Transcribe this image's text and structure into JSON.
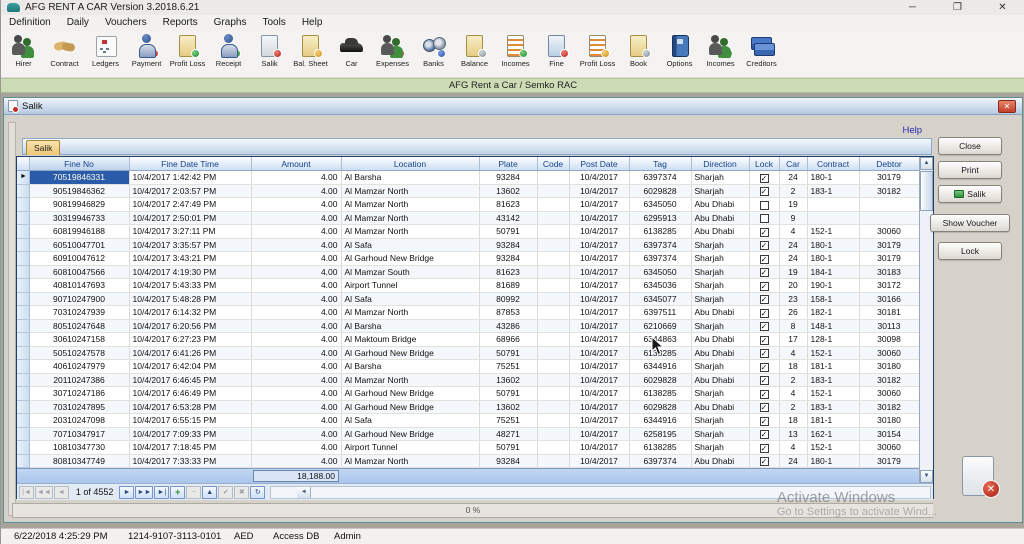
{
  "window": {
    "title": "AFG RENT A CAR Version 3.2018.6.21",
    "controls": [
      {
        "name": "minimize",
        "glyph": "─"
      },
      {
        "name": "maximize",
        "glyph": "❐"
      },
      {
        "name": "close",
        "glyph": "✕"
      }
    ]
  },
  "menu": [
    "Definition",
    "Daily",
    "Vouchers",
    "Reports",
    "Graphs",
    "Tools",
    "Help"
  ],
  "toolbar": [
    {
      "name": "hirer",
      "label": "Hirer",
      "shape": "people",
      "badge": "none"
    },
    {
      "name": "contract",
      "label": "Contract",
      "shape": "hands",
      "badge": "none"
    },
    {
      "name": "ledgers",
      "label": "Ledgers",
      "shape": "card",
      "badge": "none"
    },
    {
      "name": "payment",
      "label": "Payment",
      "shape": "person",
      "badge": "red"
    },
    {
      "name": "profit-loss-1",
      "label": "Profit Loss",
      "shape": "doc-yellow",
      "badge": "green"
    },
    {
      "name": "receipt",
      "label": "Receipt",
      "shape": "person",
      "badge": "green"
    },
    {
      "name": "salik",
      "label": "Salik",
      "shape": "doc-gray",
      "badge": "red"
    },
    {
      "name": "bal-sheet",
      "label": "Bal. Sheet",
      "shape": "doc-yellow",
      "badge": "yellow"
    },
    {
      "name": "car",
      "label": "Car",
      "shape": "car",
      "badge": "none"
    },
    {
      "name": "expenses",
      "label": "Expenses",
      "shape": "people",
      "badge": "red"
    },
    {
      "name": "banks",
      "label": "Banks",
      "shape": "binoc",
      "badge": "blue"
    },
    {
      "name": "balance",
      "label": "Balance",
      "shape": "doc-yellow",
      "badge": "gray"
    },
    {
      "name": "incomes-1",
      "label": "Incomes",
      "shape": "doc-lines",
      "badge": "green"
    },
    {
      "name": "fine",
      "label": "Fine",
      "shape": "doc-blue",
      "badge": "red"
    },
    {
      "name": "profit-loss-2",
      "label": "Profit Loss",
      "shape": "doc-lines",
      "badge": "yellow"
    },
    {
      "name": "book",
      "label": "Book",
      "shape": "doc-yellow",
      "badge": "gray"
    },
    {
      "name": "options",
      "label": "Options",
      "shape": "book",
      "badge": "none"
    },
    {
      "name": "incomes-2",
      "label": "Incomes",
      "shape": "people",
      "badge": "green"
    },
    {
      "name": "creditors",
      "label": "Creditors",
      "shape": "cards",
      "badge": "none"
    }
  ],
  "banner": "AFG Rent a Car / Semko RAC",
  "salik_window": {
    "title": "Salik",
    "close_glyph": "✕",
    "help": "Help",
    "tab": "Salik",
    "grid": {
      "columns": [
        "Fine No",
        "Fine Date Time",
        "Amount",
        "Location",
        "Plate",
        "Code",
        "Post Date",
        "Tag",
        "Direction",
        "Lock",
        "Car",
        "Contract",
        "Debtor"
      ],
      "rows": [
        [
          "70519846331",
          "10/4/2017 1:42:42 PM",
          "4.00",
          "Al Barsha",
          "93284",
          "",
          "10/4/2017",
          "6397374",
          "Sharjah",
          true,
          "24",
          "180-1",
          "30179"
        ],
        [
          "90519846362",
          "10/4/2017 2:03:57 PM",
          "4.00",
          "Al Mamzar North",
          "13602",
          "",
          "10/4/2017",
          "6029828",
          "Sharjah",
          true,
          "2",
          "183-1",
          "30182"
        ],
        [
          "90819946829",
          "10/4/2017 2:47:49 PM",
          "4.00",
          "Al Mamzar North",
          "81623",
          "",
          "10/4/2017",
          "6345050",
          "Abu Dhabi",
          false,
          "19",
          "",
          ""
        ],
        [
          "30319946733",
          "10/4/2017 2:50:01 PM",
          "4.00",
          "Al Mamzar North",
          "43142",
          "",
          "10/4/2017",
          "6295913",
          "Abu Dhabi",
          false,
          "9",
          "",
          ""
        ],
        [
          "60819946188",
          "10/4/2017 3:27:11 PM",
          "4.00",
          "Al Mamzar North",
          "50791",
          "",
          "10/4/2017",
          "6138285",
          "Abu Dhabi",
          true,
          "4",
          "152-1",
          "30060"
        ],
        [
          "60510047701",
          "10/4/2017 3:35:57 PM",
          "4.00",
          "Al Safa",
          "93284",
          "",
          "10/4/2017",
          "6397374",
          "Sharjah",
          true,
          "24",
          "180-1",
          "30179"
        ],
        [
          "60910047612",
          "10/4/2017 3:43:21 PM",
          "4.00",
          "Al Garhoud New Bridge",
          "93284",
          "",
          "10/4/2017",
          "6397374",
          "Sharjah",
          true,
          "24",
          "180-1",
          "30179"
        ],
        [
          "60810047566",
          "10/4/2017 4:19:30 PM",
          "4.00",
          "Al Mamzar South",
          "81623",
          "",
          "10/4/2017",
          "6345050",
          "Sharjah",
          true,
          "19",
          "184-1",
          "30183"
        ],
        [
          "40810147693",
          "10/4/2017 5:43:33 PM",
          "4.00",
          "Airport Tunnel",
          "81689",
          "",
          "10/4/2017",
          "6345036",
          "Sharjah",
          true,
          "20",
          "190-1",
          "30172"
        ],
        [
          "90710247900",
          "10/4/2017 5:48:28 PM",
          "4.00",
          "Al Safa",
          "80992",
          "",
          "10/4/2017",
          "6345077",
          "Sharjah",
          true,
          "23",
          "158-1",
          "30166"
        ],
        [
          "70310247939",
          "10/4/2017 6:14:32 PM",
          "4.00",
          "Al Mamzar North",
          "87853",
          "",
          "10/4/2017",
          "6397511",
          "Abu Dhabi",
          true,
          "26",
          "182-1",
          "30181"
        ],
        [
          "80510247648",
          "10/4/2017 6:20:56 PM",
          "4.00",
          "Al Barsha",
          "43286",
          "",
          "10/4/2017",
          "6210669",
          "Sharjah",
          true,
          "8",
          "148-1",
          "30113"
        ],
        [
          "30610247158",
          "10/4/2017 6:27:23 PM",
          "4.00",
          "Al Maktoum Bridge",
          "68966",
          "",
          "10/4/2017",
          "6344863",
          "Abu Dhabi",
          true,
          "17",
          "128-1",
          "30098"
        ],
        [
          "50510247578",
          "10/4/2017 6:41:26 PM",
          "4.00",
          "Al Garhoud New Bridge",
          "50791",
          "",
          "10/4/2017",
          "6138285",
          "Abu Dhabi",
          true,
          "4",
          "152-1",
          "30060"
        ],
        [
          "40610247979",
          "10/4/2017 6:42:04 PM",
          "4.00",
          "Al Barsha",
          "75251",
          "",
          "10/4/2017",
          "6344916",
          "Sharjah",
          true,
          "18",
          "181-1",
          "30180"
        ],
        [
          "20110247386",
          "10/4/2017 6:46:45 PM",
          "4.00",
          "Al Mamzar North",
          "13602",
          "",
          "10/4/2017",
          "6029828",
          "Abu Dhabi",
          true,
          "2",
          "183-1",
          "30182"
        ],
        [
          "30710247186",
          "10/4/2017 6:46:49 PM",
          "4.00",
          "Al Garhoud New Bridge",
          "50791",
          "",
          "10/4/2017",
          "6138285",
          "Sharjah",
          true,
          "4",
          "152-1",
          "30060"
        ],
        [
          "70310247895",
          "10/4/2017 6:53:28 PM",
          "4.00",
          "Al Garhoud New Bridge",
          "13602",
          "",
          "10/4/2017",
          "6029828",
          "Abu Dhabi",
          true,
          "2",
          "183-1",
          "30182"
        ],
        [
          "20310247098",
          "10/4/2017 6:55:15 PM",
          "4.00",
          "Al Safa",
          "75251",
          "",
          "10/4/2017",
          "6344916",
          "Sharjah",
          true,
          "18",
          "181-1",
          "30180"
        ],
        [
          "70710347917",
          "10/4/2017 7:09:33 PM",
          "4.00",
          "Al Garhoud New Bridge",
          "48271",
          "",
          "10/4/2017",
          "6258195",
          "Sharjah",
          true,
          "13",
          "162-1",
          "30154"
        ],
        [
          "10810347730",
          "10/4/2017 7:18:45 PM",
          "4.00",
          "Airport Tunnel",
          "50791",
          "",
          "10/4/2017",
          "6138285",
          "Sharjah",
          true,
          "4",
          "152-1",
          "30060"
        ],
        [
          "80810347749",
          "10/4/2017 7:33:33 PM",
          "4.00",
          "Al Mamzar North",
          "93284",
          "",
          "10/4/2017",
          "6397374",
          "Abu Dhabi",
          true,
          "24",
          "180-1",
          "30179"
        ]
      ],
      "total": "18,188.00"
    },
    "navigator": {
      "position": "1 of 4552",
      "buttons_left": [
        {
          "name": "first",
          "glyph": "|◄",
          "enabled": false
        },
        {
          "name": "prior-page",
          "glyph": "◄◄",
          "enabled": false
        },
        {
          "name": "prior",
          "glyph": "◄",
          "enabled": false
        }
      ],
      "buttons_right": [
        {
          "name": "next",
          "glyph": "►",
          "enabled": true
        },
        {
          "name": "next-page",
          "glyph": "►►",
          "enabled": true
        },
        {
          "name": "last",
          "glyph": "►|",
          "enabled": true
        },
        {
          "name": "insert",
          "glyph": "+",
          "enabled": true,
          "accent": "green"
        },
        {
          "name": "delete",
          "glyph": "−",
          "enabled": false
        },
        {
          "name": "edit",
          "glyph": "▲",
          "enabled": true
        },
        {
          "name": "post",
          "glyph": "✔",
          "enabled": false
        },
        {
          "name": "cancel",
          "glyph": "✖",
          "enabled": false
        },
        {
          "name": "refresh",
          "glyph": "↻",
          "enabled": true
        }
      ]
    },
    "side_buttons": [
      {
        "name": "close",
        "label": "Close"
      },
      {
        "name": "print",
        "label": "Print"
      },
      {
        "name": "salik",
        "label": "Salik",
        "icon": "green-grid"
      },
      {
        "name": "show-voucher",
        "label": "Show Voucher"
      },
      {
        "name": "lock",
        "label": "Lock"
      }
    ],
    "progress": "0 %"
  },
  "watermark": {
    "line1": "Activate Windows",
    "line2": "Go to Settings to activate Wind..."
  },
  "statusbar": [
    "6/22/2018 4:25:29 PM",
    "1214-9107-3113-0101",
    "AED",
    "Access DB",
    "Admin"
  ],
  "colors": {
    "banner_green": "#cedcb6",
    "grid_header_blue": "#cfdff3",
    "selected_cell": "#2a5caa",
    "summary_blue": "#aac6ec",
    "tab_tan": "#edc878",
    "close_red": "#c04028"
  }
}
